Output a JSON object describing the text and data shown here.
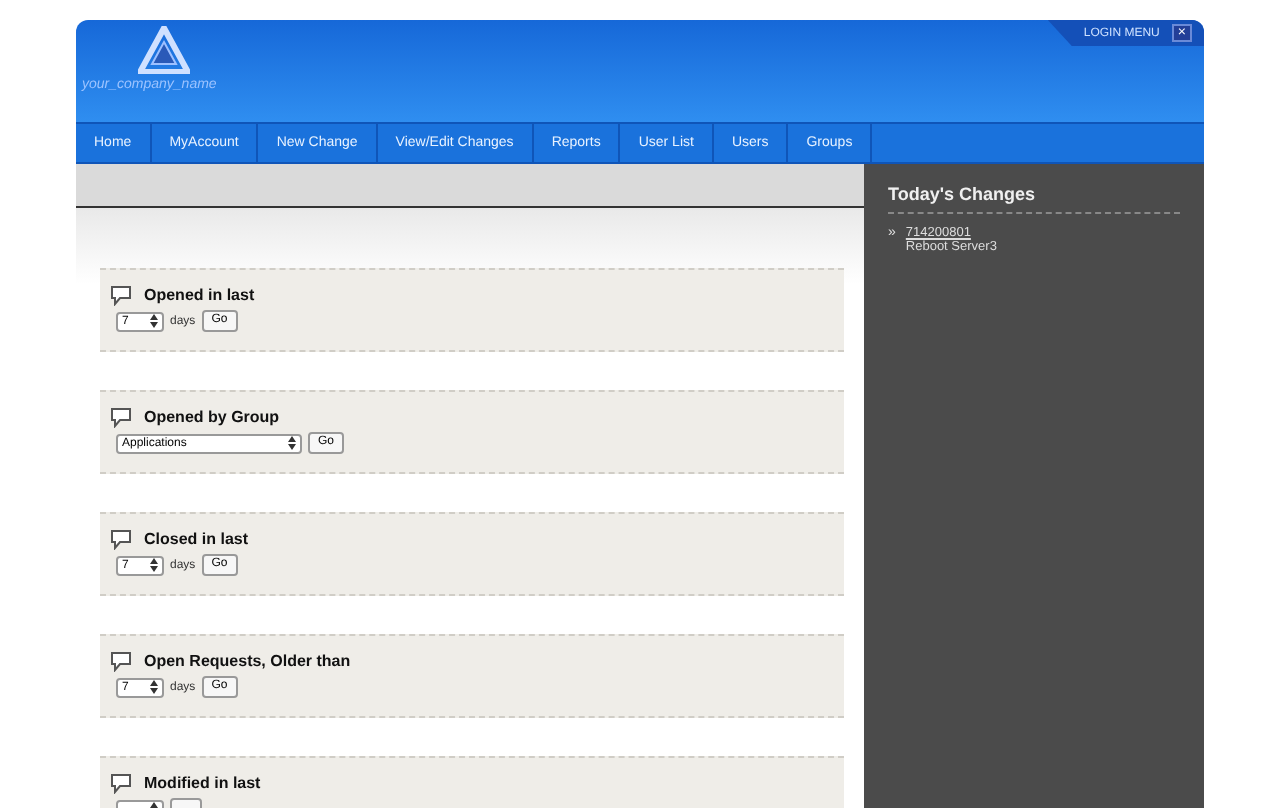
{
  "header": {
    "logo_text": "your_company_name",
    "login_menu": "LOGIN MENU",
    "login_close": "×"
  },
  "nav": [
    {
      "label": "Home"
    },
    {
      "label": "MyAccount"
    },
    {
      "label": "New Change"
    },
    {
      "label": "View/Edit Changes"
    },
    {
      "label": "Reports"
    },
    {
      "label": "User List"
    },
    {
      "label": "Users"
    },
    {
      "label": "Groups"
    }
  ],
  "reports": [
    {
      "title": "Opened in last",
      "kind": "days",
      "value": "7",
      "unit": "days",
      "button": "Go"
    },
    {
      "title": "Opened by Group",
      "kind": "group",
      "value": "Applications",
      "button": "Go"
    },
    {
      "title": "Closed in last",
      "kind": "days",
      "value": "7",
      "unit": "days",
      "button": "Go"
    },
    {
      "title": "Open Requests, Older than",
      "kind": "days",
      "value": "7",
      "unit": "days",
      "button": "Go"
    },
    {
      "title": "Modified in last",
      "kind": "days"
    }
  ],
  "sidebar": {
    "title": "Today's Changes",
    "items": [
      {
        "bullet": "»",
        "id": "714200801",
        "description": "Reboot Server3"
      }
    ]
  }
}
